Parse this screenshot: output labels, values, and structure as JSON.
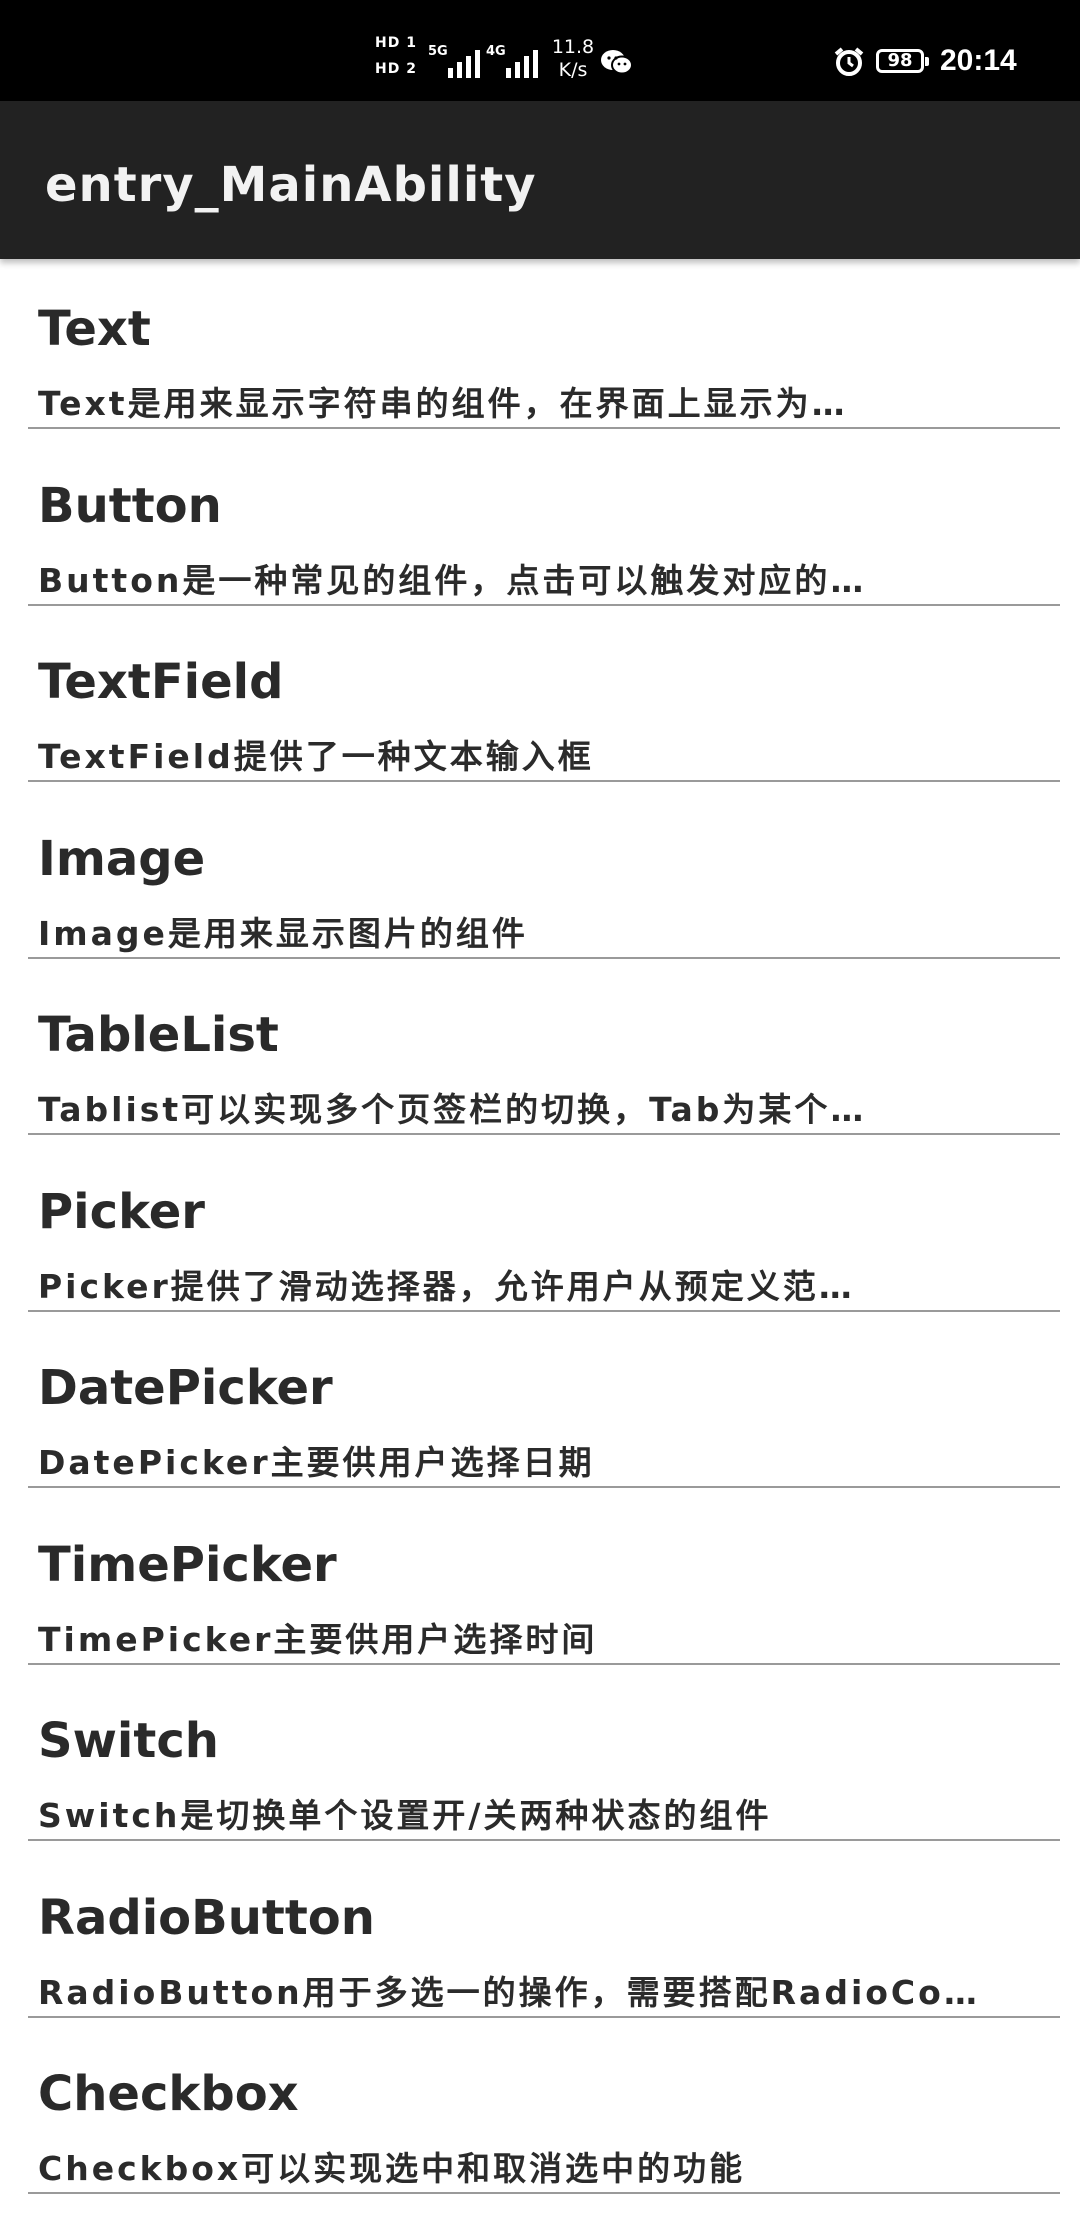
{
  "status_bar": {
    "hd1": "HD 1",
    "hd2": "HD 2",
    "signal1_tag": "5G",
    "signal2_tag": "4G",
    "speed_value": "11.8",
    "speed_unit": "K/s",
    "wechat_icon": "wechat-icon",
    "alarm_icon": "alarm-icon",
    "battery": "98",
    "time": "20:14"
  },
  "app_bar": {
    "title": "entry_MainAbility"
  },
  "list": [
    {
      "title": "Text",
      "desc": "Text是用来显示字符串的组件，在界面上显示为…"
    },
    {
      "title": "Button",
      "desc": "Button是一种常见的组件，点击可以触发对应的…"
    },
    {
      "title": "TextField",
      "desc": "TextField提供了一种文本输入框"
    },
    {
      "title": "Image",
      "desc": "Image是用来显示图片的组件"
    },
    {
      "title": "TableList",
      "desc": "Tablist可以实现多个页签栏的切换，Tab为某个…"
    },
    {
      "title": "Picker",
      "desc": "Picker提供了滑动选择器，允许用户从预定义范…"
    },
    {
      "title": "DatePicker",
      "desc": "DatePicker主要供用户选择日期"
    },
    {
      "title": "TimePicker",
      "desc": "TimePicker主要供用户选择时间"
    },
    {
      "title": "Switch",
      "desc": "Switch是切换单个设置开/关两种状态的组件"
    },
    {
      "title": "RadioButton",
      "desc": "RadioButton用于多选一的操作，需要搭配RadioCo…"
    },
    {
      "title": "Checkbox",
      "desc": "Checkbox可以实现选中和取消选中的功能"
    }
  ]
}
